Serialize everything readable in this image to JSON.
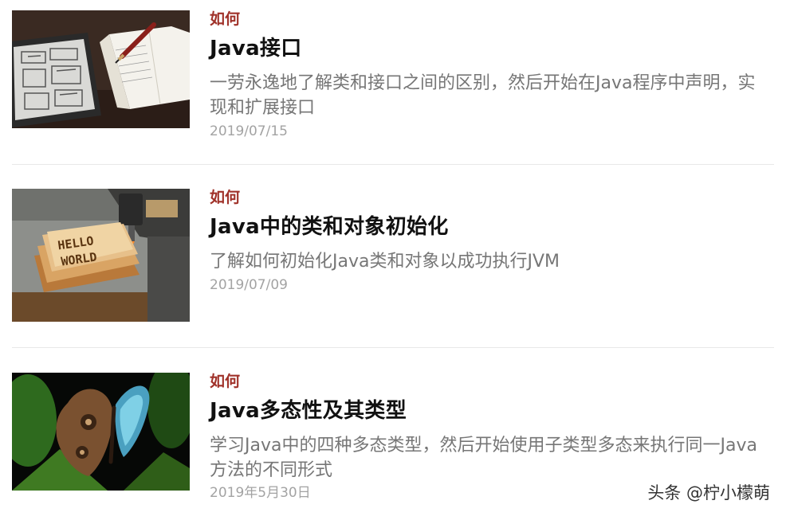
{
  "articles": [
    {
      "category": "如何",
      "title": "Java接口",
      "summary": "一劳永逸地了解类和接口之间的区别，然后开始在Java程序中声明，实现和扩展接口",
      "date": "2019/07/15",
      "image": "tablet-and-notebook-photo"
    },
    {
      "category": "如何",
      "title": "Java中的类和对象初始化",
      "summary": "了解如何初始化Java类和对象以成功执行JVM",
      "date": "2019/07/09",
      "image": "hello-world-toast-photo"
    },
    {
      "category": "如何",
      "title": "Java多态性及其类型",
      "summary": "学习Java中的四种多态类型，然后开始使用子类型多态来执行同一Java方法的不同形式",
      "date": "2019年5月30日",
      "image": "butterfly-photo"
    }
  ],
  "watermark": "头条 @柠小檬萌",
  "colors": {
    "category": "#a0322a",
    "title": "#111111",
    "summary": "#767676",
    "date": "#a3a3a3",
    "divider": "#e8e8e8"
  }
}
